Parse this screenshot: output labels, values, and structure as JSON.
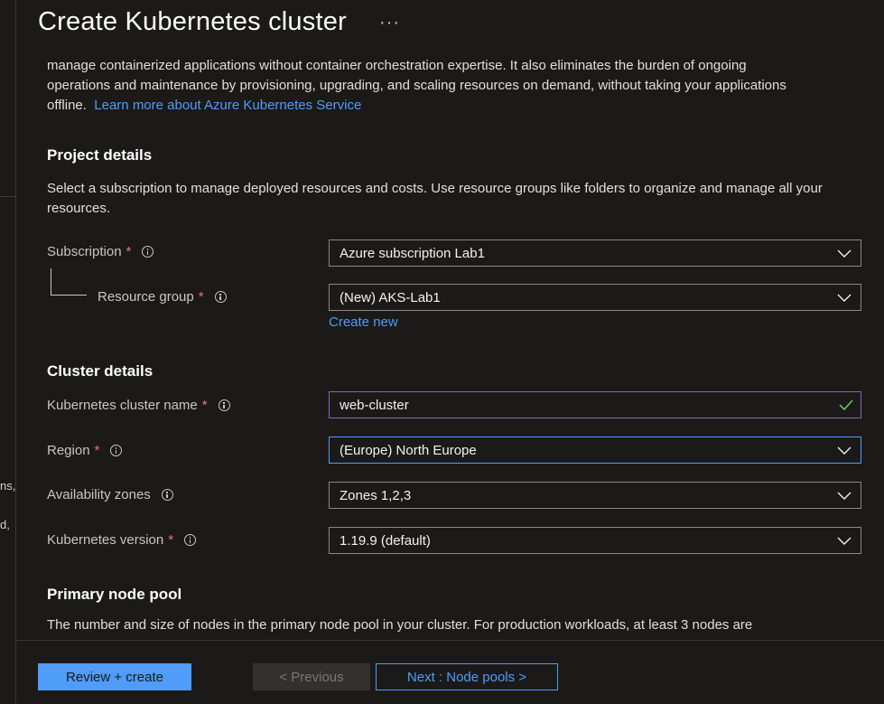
{
  "left_pane": {
    "fragments": [
      "ns,",
      "d,"
    ]
  },
  "header": {
    "title": "Create Kubernetes cluster",
    "more": "···"
  },
  "intro": {
    "line1": "manage containerized applications without container orchestration expertise. It also eliminates the burden of ongoing",
    "line2": "operations and maintenance by provisioning, upgrading, and scaling resources on demand, without taking your applications",
    "line3": "offline.",
    "link": "Learn more about Azure Kubernetes Service"
  },
  "project_details": {
    "heading": "Project details",
    "description": "Select a subscription to manage deployed resources and costs. Use resource groups like folders to organize and manage all your resources.",
    "subscription": {
      "label": "Subscription",
      "required": "*",
      "value": "Azure subscription Lab1"
    },
    "resource_group": {
      "label": "Resource group",
      "required": "*",
      "value": "(New) AKS-Lab1",
      "create_new": "Create new"
    }
  },
  "cluster_details": {
    "heading": "Cluster details",
    "cluster_name": {
      "label": "Kubernetes cluster name",
      "required": "*",
      "value": "web-cluster"
    },
    "region": {
      "label": "Region",
      "required": "*",
      "value": "(Europe) North Europe"
    },
    "availability_zones": {
      "label": "Availability zones",
      "value": "Zones 1,2,3"
    },
    "kubernetes_version": {
      "label": "Kubernetes version",
      "required": "*",
      "value": "1.19.9 (default)"
    }
  },
  "primary_node_pool": {
    "heading": "Primary node pool",
    "description": "The number and size of nodes in the primary node pool in your cluster. For production workloads, at least 3 nodes are"
  },
  "footer": {
    "review_create": "Review + create",
    "previous": "< Previous",
    "next": "Next : Node pools >"
  },
  "colors": {
    "background": "#1b1a19",
    "accent": "#4f9cf9",
    "required": "#f1707b",
    "valid_check": "#6ccb5f",
    "input_focus_border": "#8764b8"
  }
}
